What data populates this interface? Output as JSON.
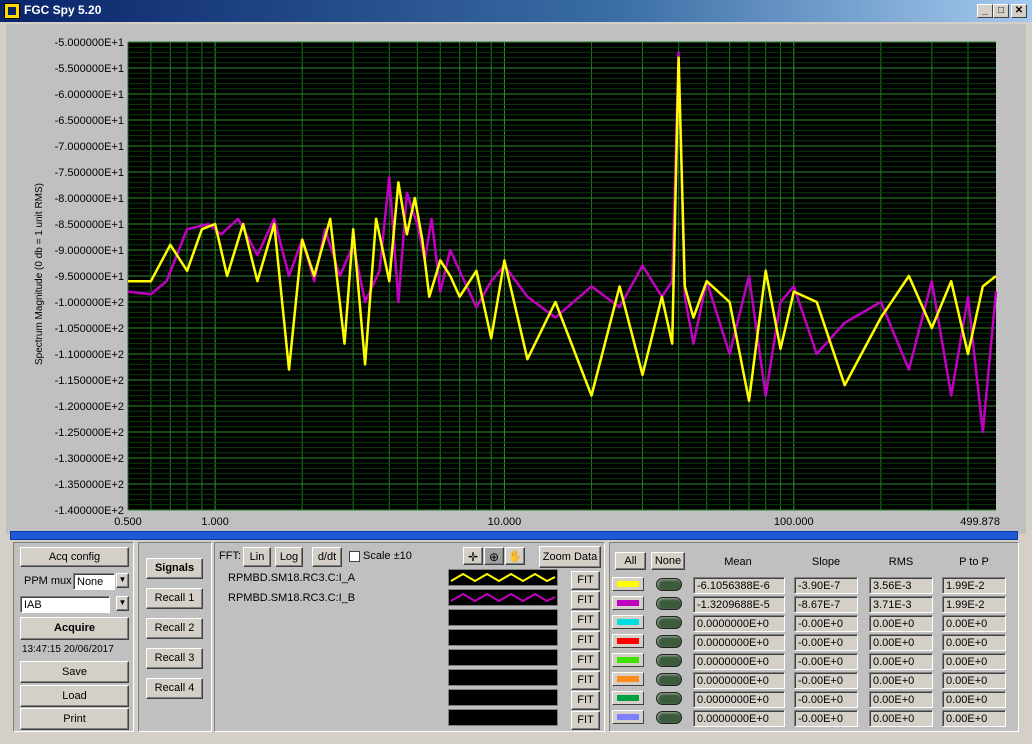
{
  "window": {
    "title": "FGC Spy 5.20",
    "controls": [
      "_",
      "□",
      "✕"
    ]
  },
  "chart_data": {
    "type": "line",
    "xlabel": "",
    "ylabel": "Spectrum Magnitude (0 db = 1 unit RMS)",
    "xscale": "log",
    "xlim": [
      0.5,
      499.878
    ],
    "ylim": [
      -140,
      -50
    ],
    "x_tick_labels": [
      "0.500",
      "1.000",
      "10.000",
      "100.000",
      "499.878"
    ],
    "y_tick_labels": [
      "-5.000000E+1",
      "-5.500000E+1",
      "-6.000000E+1",
      "-6.500000E+1",
      "-7.000000E+1",
      "-7.500000E+1",
      "-8.000000E+1",
      "-8.500000E+1",
      "-9.000000E+1",
      "-9.500000E+1",
      "-1.000000E+2",
      "-1.050000E+2",
      "-1.100000E+2",
      "-1.150000E+2",
      "-1.200000E+2",
      "-1.250000E+2",
      "-1.300000E+2",
      "-1.350000E+2",
      "-1.400000E+2"
    ],
    "background": "#000000",
    "grid_color": "#1f7a1f",
    "series": [
      {
        "color": "#c000c0",
        "x": [
          0.5,
          0.6,
          0.68,
          0.8,
          0.95,
          1.05,
          1.2,
          1.4,
          1.6,
          1.8,
          2.0,
          2.2,
          2.4,
          2.7,
          3.0,
          3.3,
          3.7,
          4.0,
          4.3,
          4.6,
          5.0,
          5.3,
          5.6,
          6.0,
          6.5,
          7.0,
          8.0,
          9.0,
          10.0,
          12.0,
          15.0,
          20.0,
          25.0,
          30.0,
          35.0,
          38.0,
          40.0,
          42.0,
          45.0,
          50.0,
          60.0,
          70.0,
          80.0,
          90.0,
          100.0,
          120.0,
          150.0,
          200.0,
          250.0,
          300.0,
          350.0,
          400.0,
          450.0,
          499.878
        ],
        "y": [
          -98,
          -98.5,
          -96,
          -86,
          -85,
          -87,
          -84,
          -91,
          -84,
          -95,
          -88,
          -96,
          -86,
          -95,
          -89,
          -100,
          -94,
          -76,
          -100,
          -79,
          -85,
          -92,
          -84,
          -98,
          -90,
          -94,
          -101,
          -96,
          -93,
          -99,
          -103,
          -97,
          -101,
          -93,
          -99,
          -96,
          -52,
          -99,
          -108,
          -96,
          -110,
          -95,
          -118,
          -100,
          -97,
          -110,
          -104,
          -100,
          -113,
          -96,
          -118,
          -99,
          -125,
          -98
        ]
      },
      {
        "color": "#ffff00",
        "x": [
          0.5,
          0.6,
          0.7,
          0.8,
          0.9,
          1.0,
          1.1,
          1.25,
          1.4,
          1.6,
          1.8,
          2.0,
          2.2,
          2.5,
          2.8,
          3.0,
          3.3,
          3.6,
          4.0,
          4.3,
          4.6,
          4.9,
          5.2,
          5.5,
          6.0,
          6.5,
          7.0,
          8.0,
          9.0,
          10.0,
          12.0,
          15.0,
          20.0,
          25.0,
          30.0,
          35.0,
          38.0,
          40.0,
          42.0,
          45.0,
          50.0,
          60.0,
          70.0,
          80.0,
          90.0,
          100.0,
          120.0,
          150.0,
          200.0,
          250.0,
          300.0,
          350.0,
          400.0,
          450.0,
          499.878
        ],
        "y": [
          -96,
          -96,
          -89,
          -94,
          -86,
          -85,
          -95,
          -85,
          -96,
          -85,
          -113,
          -88,
          -95,
          -84,
          -108,
          -86,
          -112,
          -84,
          -96,
          -77,
          -87,
          -80,
          -88,
          -99,
          -92,
          -95,
          -99,
          -94,
          -107,
          -92,
          -111,
          -100,
          -118,
          -97,
          -114,
          -99,
          -108,
          -53,
          -97,
          -103,
          -96,
          -100,
          -119,
          -94,
          -109,
          -98,
          -100,
          -116,
          -103,
          -95,
          -105,
          -96,
          -110,
          -97,
          -95
        ]
      }
    ]
  },
  "left_panel": {
    "acq_config": "Acq config",
    "ppm_mux_label": "PPM mux",
    "ppm_mux_value": "None",
    "signal_select": "IAB",
    "acquire": "Acquire",
    "timestamp": "13:47:15 20/06/2017",
    "save": "Save",
    "load": "Load",
    "print": "Print"
  },
  "signals_panel": {
    "signals": "Signals",
    "recall": [
      "Recall 1",
      "Recall 2",
      "Recall 3",
      "Recall 4"
    ]
  },
  "fft_toolbar": {
    "fft_label": "FFT:",
    "lin": "Lin",
    "log": "Log",
    "ddt": "d/dt",
    "scale_label": "Scale ±10",
    "zoom_data": "Zoom Data"
  },
  "signal_list": [
    {
      "name": "RPMBD.SM18.RC3.C:I_A",
      "color": "#ffff00",
      "fit": "FIT"
    },
    {
      "name": "RPMBD.SM18.RC3.C:I_B",
      "color": "#c000c0",
      "fit": "FIT"
    },
    {
      "name": "",
      "color": "",
      "fit": "FIT"
    },
    {
      "name": "",
      "color": "",
      "fit": "FIT"
    },
    {
      "name": "",
      "color": "",
      "fit": "FIT"
    },
    {
      "name": "",
      "color": "",
      "fit": "FIT"
    },
    {
      "name": "",
      "color": "",
      "fit": "FIT"
    },
    {
      "name": "",
      "color": "",
      "fit": "FIT"
    }
  ],
  "stats": {
    "all": "All",
    "none": "None",
    "headers": [
      "Mean",
      "Slope",
      "RMS",
      "P to P"
    ],
    "rows": [
      {
        "color": "#ffff00",
        "mean": "-6.1056388E-6",
        "slope": "-3.90E-7",
        "rms": "3.56E-3",
        "ptp": "1.99E-2"
      },
      {
        "color": "#c000c0",
        "mean": "-1.3209688E-5",
        "slope": "-8.67E-7",
        "rms": "3.71E-3",
        "ptp": "1.99E-2"
      },
      {
        "color": "#00e0e0",
        "mean": "0.0000000E+0",
        "slope": "-0.00E+0",
        "rms": "0.00E+0",
        "ptp": "0.00E+0"
      },
      {
        "color": "#ff0000",
        "mean": "0.0000000E+0",
        "slope": "-0.00E+0",
        "rms": "0.00E+0",
        "ptp": "0.00E+0"
      },
      {
        "color": "#40e000",
        "mean": "0.0000000E+0",
        "slope": "-0.00E+0",
        "rms": "0.00E+0",
        "ptp": "0.00E+0"
      },
      {
        "color": "#ff8c1a",
        "mean": "0.0000000E+0",
        "slope": "-0.00E+0",
        "rms": "0.00E+0",
        "ptp": "0.00E+0"
      },
      {
        "color": "#00a040",
        "mean": "0.0000000E+0",
        "slope": "-0.00E+0",
        "rms": "0.00E+0",
        "ptp": "0.00E+0"
      },
      {
        "color": "#8080ff",
        "mean": "0.0000000E+0",
        "slope": "-0.00E+0",
        "rms": "0.00E+0",
        "ptp": "0.00E+0"
      }
    ]
  }
}
